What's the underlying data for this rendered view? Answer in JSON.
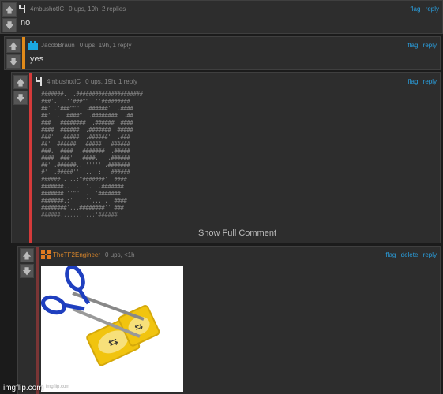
{
  "comments": [
    {
      "username": "4mbushotIC",
      "meta": "0 ups, 19h, 2 replies",
      "actions": [
        "flag",
        "reply"
      ],
      "text": "no"
    },
    {
      "username": "JacobBraun",
      "meta": "0 ups, 19h, 1 reply",
      "actions": [
        "flag",
        "reply"
      ],
      "text": "yes"
    },
    {
      "username": "4mbushotIC",
      "meta": "0 ups, 19h, 1 reply",
      "actions": [
        "flag",
        "reply"
      ],
      "ascii_art": "#######.  .#####################\n###'.   ''###\"\"  ''#########\n##' .'###\"\"\"  .######'  .####\n##'  .  ####\"  .########  .##\n###   ########  .######  ####\n####  ######  .#######  #####\n###'  .#####  .######'  .###\n##'  ######  .#####   ######\n###.  ####  .#######  .#####\n####  ###'  .####.   .######\n##' .######.. '''''..#######\n#'  .#####'' ...  :.  ######\n######'. ..:\"#######'  ####\n#######..  ...'.  .#######\n####### ''\"\"'..  '#######\n#######.:'  .'''.....  ####\n########'...########'' ###\n######..........:'######",
      "show_full": "Show Full Comment"
    },
    {
      "username": "TheTF2Engineer",
      "meta": "0 ups, <1h",
      "actions": [
        "flag",
        "delete",
        "reply"
      ],
      "image_caption": "imgflip.com"
    }
  ],
  "watermark": "imgflip.com",
  "colors": {
    "accent_link": "#2aa0e0",
    "bar_orange": "#e08a1a",
    "bar_red": "#d43a3a",
    "bar_dark_red": "#7a3535"
  },
  "icons": {
    "upvote": "arrow-up-icon",
    "downvote": "arrow-down-icon"
  }
}
